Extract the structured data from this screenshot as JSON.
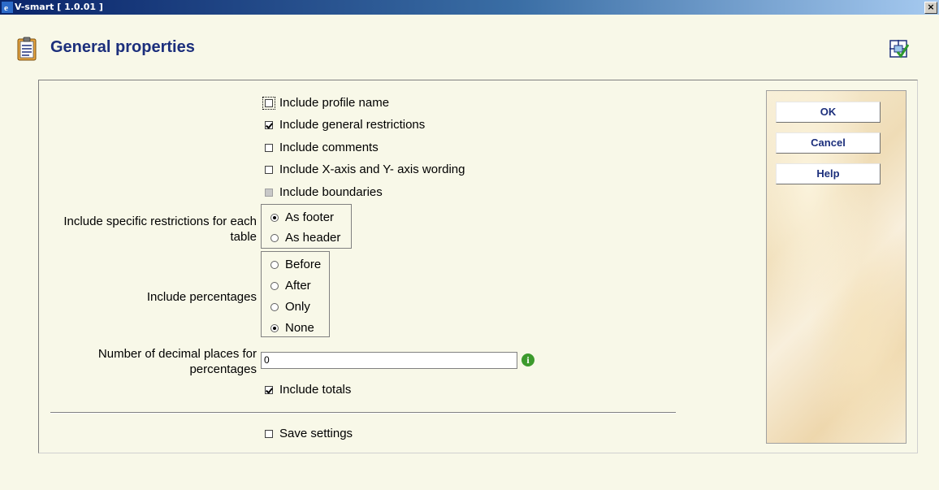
{
  "window": {
    "title": "V-smart [ 1.0.01 ]",
    "close_label": "×"
  },
  "header": {
    "title": "General properties"
  },
  "options": [
    {
      "label": "Include profile name",
      "checked": false
    },
    {
      "label": "Include general restrictions",
      "checked": true
    },
    {
      "label": "Include comments",
      "checked": false
    },
    {
      "label": "Include X-axis and Y- axis wording",
      "checked": false
    },
    {
      "label": "Include boundaries",
      "checked": false,
      "disabled": true
    }
  ],
  "specific_restrictions": {
    "label": "Include specific restrictions for each table",
    "options": [
      {
        "label": "As footer",
        "selected": true
      },
      {
        "label": "As header",
        "selected": false
      }
    ]
  },
  "percentages": {
    "label": "Include percentages",
    "options": [
      {
        "label": "Before",
        "selected": false
      },
      {
        "label": "After",
        "selected": false
      },
      {
        "label": "Only",
        "selected": false
      },
      {
        "label": "None",
        "selected": true
      }
    ]
  },
  "decimal_places": {
    "label": "Number of decimal places for percentages",
    "value": "0"
  },
  "include_totals": {
    "label": "Include totals",
    "checked": true
  },
  "save_settings": {
    "label": "Save settings",
    "checked": false
  },
  "buttons": {
    "ok": "OK",
    "cancel": "Cancel",
    "help": "Help"
  },
  "icons": {
    "page": "clipboard-icon",
    "save": "save-settings-icon",
    "info": "info-icon",
    "app": "ie-icon"
  },
  "colors": {
    "title": "#1C2F7C",
    "background": "#F8F8E8",
    "info": "#3C9A2C"
  }
}
